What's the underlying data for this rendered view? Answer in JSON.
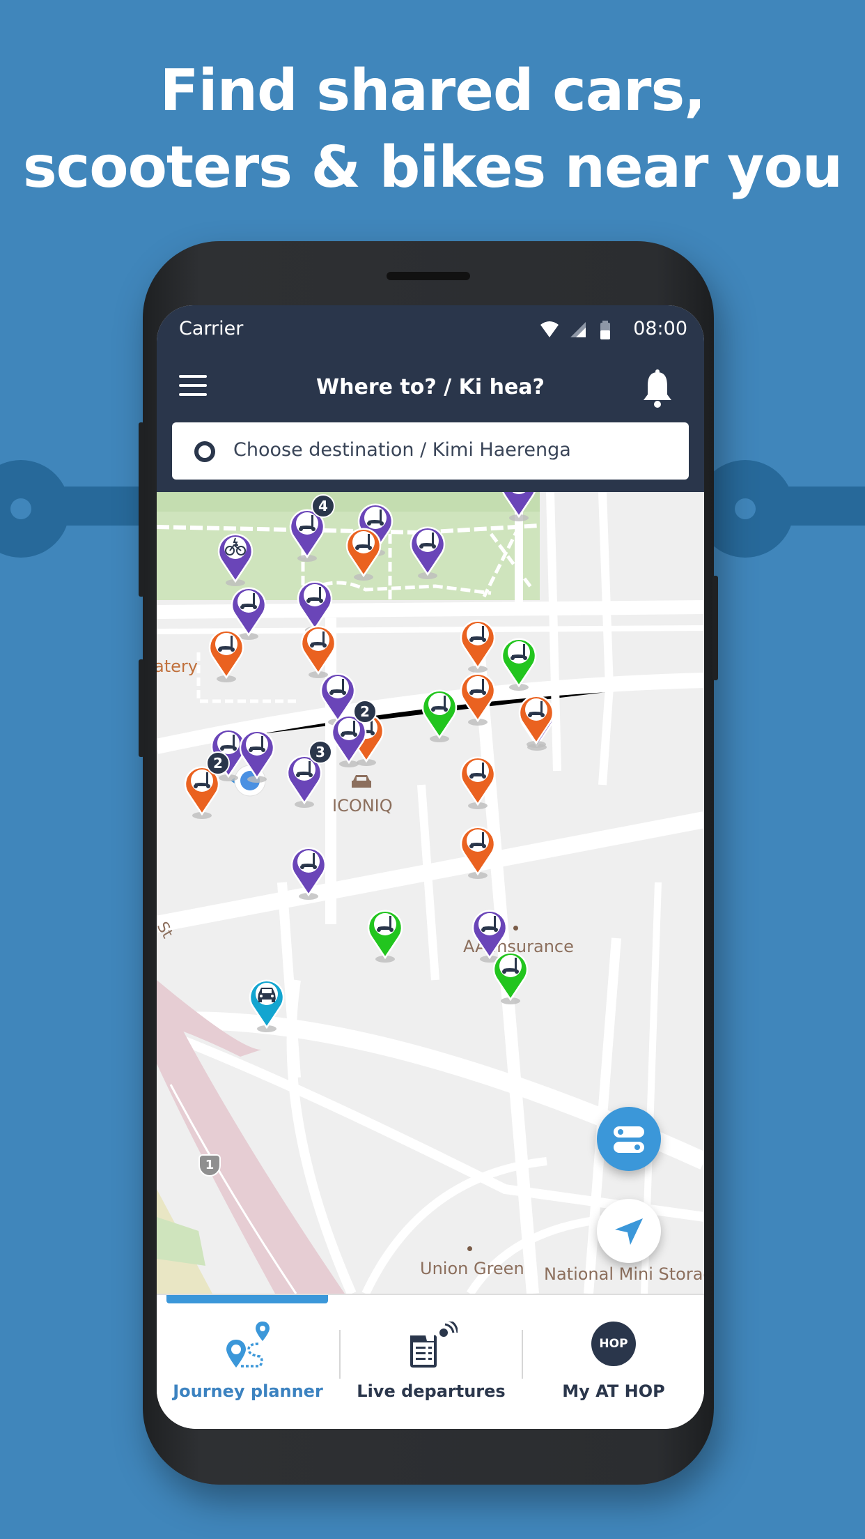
{
  "promo": {
    "headline_line1": "Find shared cars,",
    "headline_line2": "scooters & bikes near you",
    "background_color": "#4086bb"
  },
  "status_bar": {
    "carrier": "Carrier",
    "time": "08:00",
    "icons": [
      "wifi-icon",
      "cellular-signal-icon",
      "battery-icon"
    ]
  },
  "header": {
    "title": "Where to? / Ki hea?",
    "menu_icon": "hamburger-menu-icon",
    "notification_icon": "bell-icon"
  },
  "destination_input": {
    "placeholder": "Choose destination / Kimi Haerenga",
    "value": ""
  },
  "map": {
    "labels": {
      "eatery": "atery",
      "iconiq": "ICONIQ",
      "aa_insurance": "AA Insurance",
      "union_green": "Union Green",
      "national_mini_storage": "National Mini Storage",
      "street": "St",
      "highway_shield": "1"
    },
    "colors": {
      "purple": "#6a45b8",
      "orange": "#ea6220",
      "green": "#22c51e",
      "cyan": "#13a5d0",
      "badge": "#2a364b"
    },
    "markers": [
      {
        "type": "ebike",
        "color": "purple",
        "count": null
      },
      {
        "type": "scooter",
        "color": "purple",
        "count": "4"
      },
      {
        "type": "scooter",
        "color": "purple",
        "count": null
      },
      {
        "type": "scooter",
        "color": "orange",
        "count": null
      },
      {
        "type": "scooter",
        "color": "purple",
        "count": null
      },
      {
        "type": "scooter",
        "color": "purple",
        "count": null
      },
      {
        "type": "scooter",
        "color": "purple",
        "count": null
      },
      {
        "type": "scooter",
        "color": "purple",
        "count": null
      },
      {
        "type": "scooter",
        "color": "orange",
        "count": null
      },
      {
        "type": "scooter",
        "color": "orange",
        "count": null
      },
      {
        "type": "scooter",
        "color": "purple",
        "count": null
      },
      {
        "type": "scooter",
        "color": "orange",
        "count": null
      },
      {
        "type": "scooter",
        "color": "green",
        "count": null
      },
      {
        "type": "scooter",
        "color": "orange",
        "count": null
      },
      {
        "type": "scooter",
        "color": "green",
        "count": null
      },
      {
        "type": "scooter",
        "color": "orange",
        "count": null
      },
      {
        "type": "scooter",
        "color": "purple",
        "count": null
      },
      {
        "type": "scooter",
        "color": "orange",
        "count": null
      },
      {
        "type": "scooter",
        "color": "purple",
        "count": "2"
      },
      {
        "type": "scooter",
        "color": "purple",
        "count": null
      },
      {
        "type": "scooter",
        "color": "purple",
        "count": null
      },
      {
        "type": "scooter",
        "color": "purple",
        "count": "3"
      },
      {
        "type": "scooter",
        "color": "orange",
        "count": "2"
      },
      {
        "type": "scooter",
        "color": "orange",
        "count": null
      },
      {
        "type": "scooter",
        "color": "orange",
        "count": null
      },
      {
        "type": "scooter",
        "color": "purple",
        "count": null
      },
      {
        "type": "scooter",
        "color": "green",
        "count": null
      },
      {
        "type": "scooter",
        "color": "purple",
        "count": null
      },
      {
        "type": "scooter",
        "color": "green",
        "count": null
      },
      {
        "type": "car",
        "color": "cyan",
        "count": null
      }
    ],
    "filter_button_icon": "toggle-filter-icon",
    "locate_button_icon": "navigation-arrow-icon"
  },
  "tabs": [
    {
      "label": "Journey planner",
      "icon": "journey-planner-icon",
      "active": true
    },
    {
      "label": "Live departures",
      "icon": "live-departures-icon",
      "active": false
    },
    {
      "label": "My AT HOP",
      "icon": "hop-card-icon",
      "active": false
    }
  ],
  "hop_icon_text": "HOP",
  "accent_color": "#3b97d9"
}
